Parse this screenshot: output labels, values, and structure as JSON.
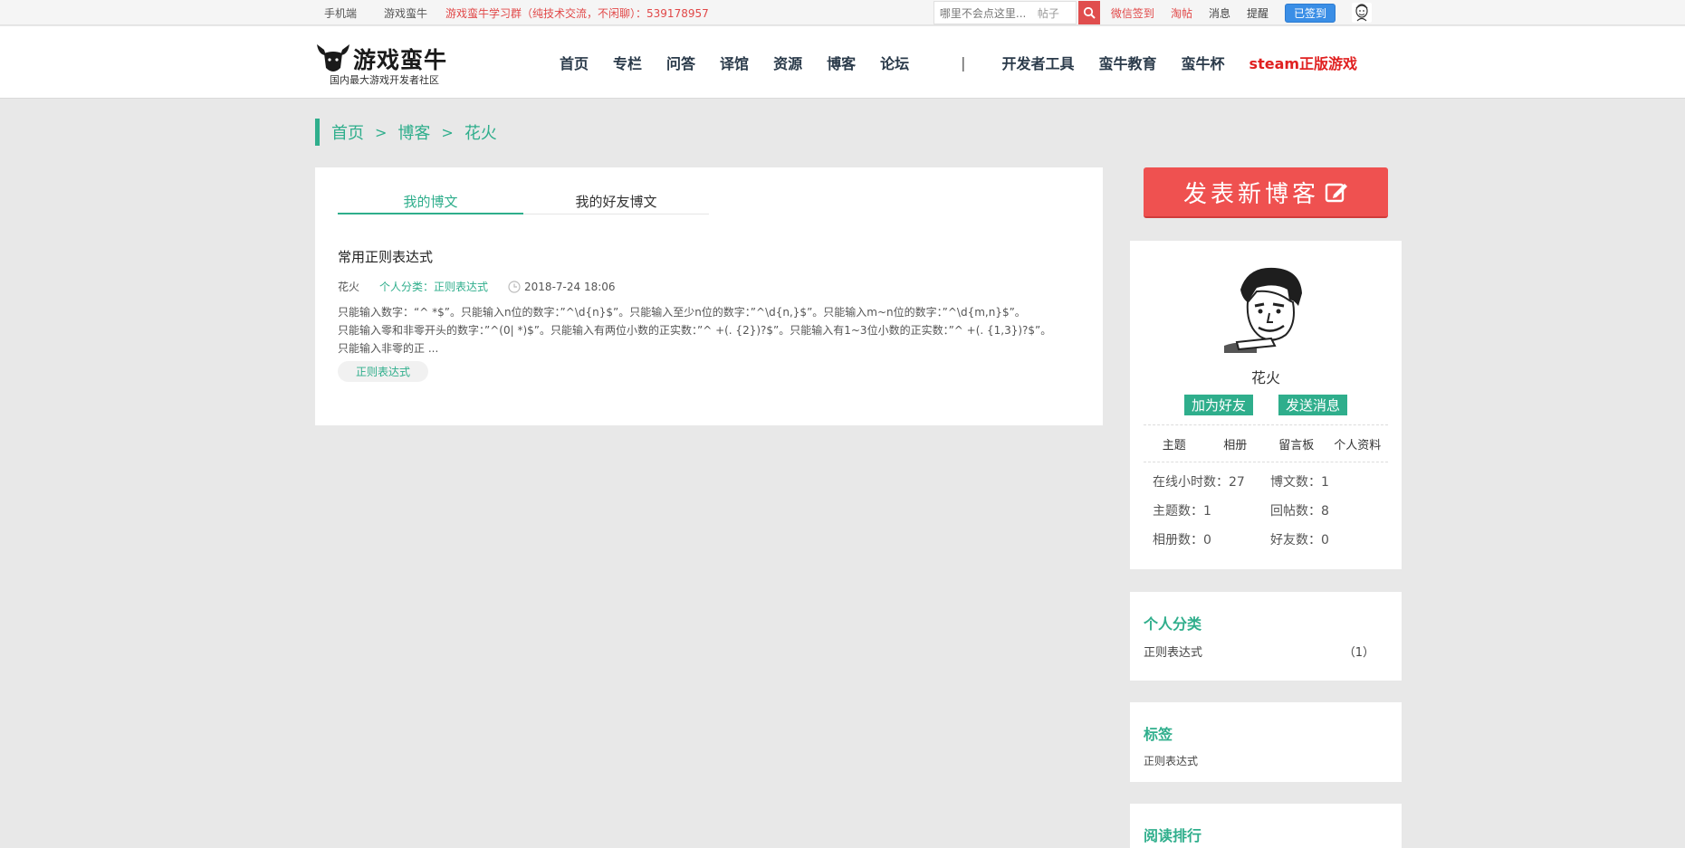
{
  "topbar": {
    "mobile": "手机端",
    "site": "游戏蛮牛",
    "promo": "游戏蛮牛学习群（纯技术交流，不闲聊）：539178957",
    "search_placeholder": "哪里不会点这里...",
    "search_scope": "帖子",
    "links": {
      "wechat_signin": "微信签到",
      "taotie": "淘帖",
      "messages": "消息",
      "reminders": "提醒"
    },
    "signed_label": "已签到"
  },
  "header": {
    "logo_title": "游戏蛮牛",
    "logo_subtitle": "国内最大游戏开发者社区",
    "nav": [
      "首页",
      "专栏",
      "问答",
      "译馆",
      "资源",
      "博客",
      "论坛"
    ],
    "divider": "|",
    "nav_right": [
      "开发者工具",
      "蛮牛教育",
      "蛮牛杯"
    ],
    "steam": "steam正版游戏"
  },
  "breadcrumb": {
    "items": [
      "首页",
      "博客",
      "花火"
    ],
    "separator": ">"
  },
  "tabs": {
    "my_posts": "我的博文",
    "friend_posts": "我的好友博文"
  },
  "post": {
    "title": "常用正则表达式",
    "author": "花火",
    "category": "个人分类：正则表达式",
    "datetime": "2018-7-24 18:06",
    "excerpt_line1": "只能输入数字：“^ *$”。只能输入n位的数字：”^\\d{n}$”。只能输入至少n位的数字：”^\\d{n,}$”。只能输入m~n位的数字：”^\\d{m,n}$”。",
    "excerpt_line2": "只能输入零和非零开头的数字：”^(0| *)$”。只能输入有两位小数的正实数：”^ +(. {2})?$”。只能输入有1~3位小数的正实数：”^ +(. {1,3})?$”。",
    "excerpt_line3": "只能输入非零的正 ...",
    "tag": "正则表达式"
  },
  "sidebar": {
    "publish_label": "发表新博客",
    "profile": {
      "name": "花火",
      "add_friend": "加为好友",
      "send_message": "发送消息",
      "tabs": [
        "主题",
        "相册",
        "留言板",
        "个人资料"
      ],
      "stats": {
        "online_hours": "在线小时数：27",
        "blog_count": "博文数：1",
        "topic_count": "主题数：1",
        "reply_count": "回帖数：8",
        "album_count": "相册数：0",
        "friend_count": "好友数：0"
      }
    },
    "categories": {
      "title": "个人分类",
      "items": [
        {
          "name": "正则表达式",
          "count": "（1）"
        }
      ]
    },
    "tags": {
      "title": "标签",
      "items": [
        "正则表达式"
      ]
    },
    "reading_rank": {
      "title": "阅读排行"
    }
  },
  "colors": {
    "accent_green": "#2fae8c",
    "publish_red": "#ef5150",
    "promo_red": "#e14848",
    "signed_blue": "#3a8ee6"
  }
}
